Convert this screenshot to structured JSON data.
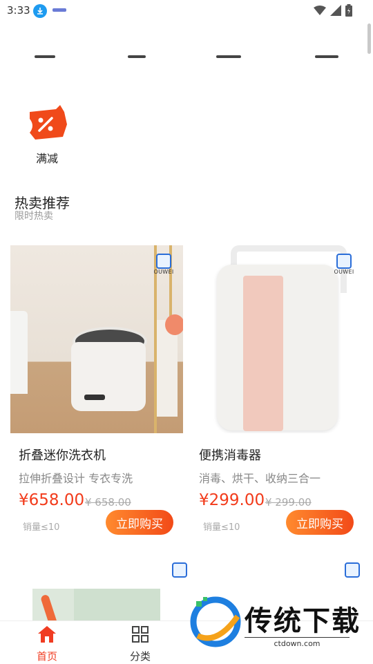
{
  "status": {
    "time": "3:33",
    "icons": [
      "download-badge-icon",
      "app-logo-icon",
      "wifi-icon",
      "signal-icon",
      "battery-icon"
    ]
  },
  "promo": {
    "label": "满减",
    "icon": "coupon-percent-icon",
    "color": "#f04a1a"
  },
  "section": {
    "title": "热卖推荐",
    "subtitle": "限时热卖"
  },
  "products": [
    {
      "title": "折叠迷你洗衣机",
      "desc": "拉伸折叠设计 专衣专洗",
      "price": "¥658.00",
      "original": "¥ 658.00",
      "sold": "销量≤10",
      "buy": "立即购买"
    },
    {
      "title": "便携消毒器",
      "desc": "消毒、烘干、收纳三合一",
      "price": "¥299.00",
      "original": "¥ 299.00",
      "sold": "销量≤10",
      "buy": "立即购买"
    }
  ],
  "brand": {
    "name": "OUWEI"
  },
  "nav": [
    {
      "label": "首页",
      "icon": "home-icon",
      "active": true
    },
    {
      "label": "分类",
      "icon": "grid-icon",
      "active": false
    }
  ],
  "watermark": {
    "title": "传统下载",
    "url": "ctdown.com"
  },
  "colors": {
    "accent": "#f23b1b",
    "button_start": "#ff8a2e",
    "button_end": "#f24a18",
    "nav_active": "#f03c22"
  }
}
